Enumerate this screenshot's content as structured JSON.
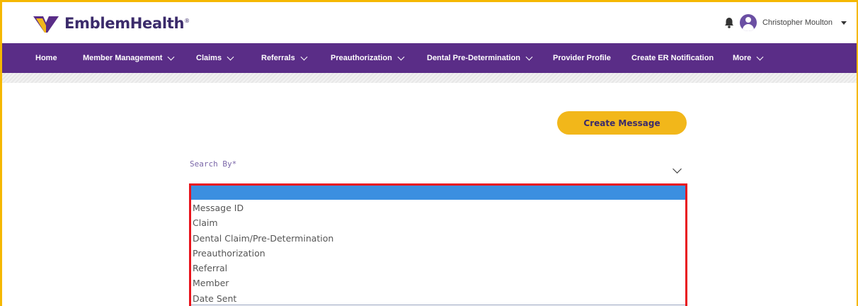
{
  "header": {
    "brand": "EmblemHealth",
    "brand_mark": "®",
    "user_name": "Christopher Moulton"
  },
  "nav": {
    "items": [
      {
        "label": "Home",
        "has_menu": false
      },
      {
        "label": "Member Management",
        "has_menu": true
      },
      {
        "label": "Claims",
        "has_menu": true
      },
      {
        "label": "Referrals",
        "has_menu": true
      },
      {
        "label": "Preauthorization",
        "has_menu": true
      },
      {
        "label": "Dental Pre-Determination",
        "has_menu": true
      },
      {
        "label": "Provider Profile",
        "has_menu": false
      },
      {
        "label": "Create ER Notification",
        "has_menu": false
      },
      {
        "label": "More",
        "has_menu": true
      }
    ]
  },
  "main": {
    "create_button": "Create Message",
    "search_label": "Search By*",
    "search_options": [
      "",
      "Message ID",
      "Claim",
      "Dental Claim/Pre-Determination",
      "Preauthorization",
      "Referral",
      "Member",
      "Date Sent"
    ]
  },
  "colors": {
    "brand_purple": "#5a2d87",
    "accent_yellow": "#f2b71a",
    "selected_option": "#3b8fe0",
    "highlight_border": "#e8141c"
  },
  "icons": [
    "emblem-logo-icon",
    "bell-icon",
    "avatar-icon",
    "caret-down-icon",
    "chevron-down-icon"
  ]
}
